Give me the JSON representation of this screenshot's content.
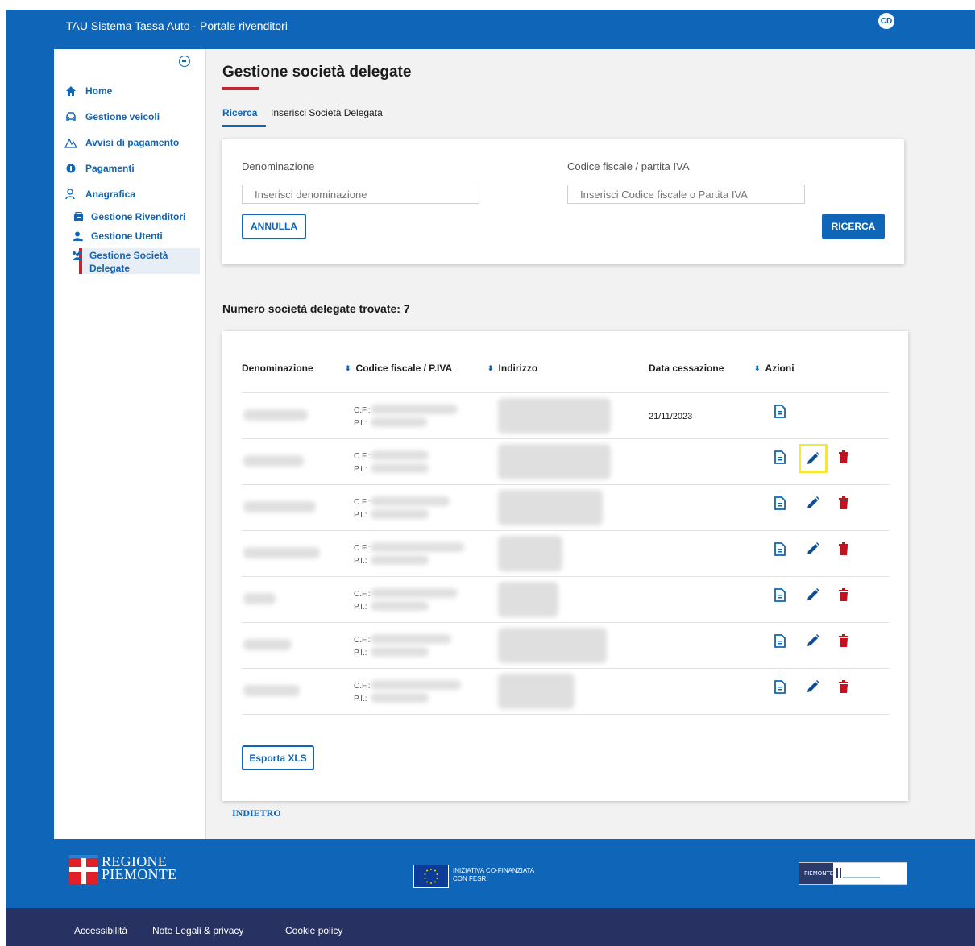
{
  "header": {
    "app_title": "TAU Sistema Tassa Auto - Portale rivenditori",
    "user_initials": "CD"
  },
  "sidebar": {
    "items": [
      {
        "label": "Home",
        "icon": "home-icon"
      },
      {
        "label": "Gestione veicoli",
        "icon": "car-icon"
      },
      {
        "label": "Avvisi di pagamento",
        "icon": "warning-triangle-icon"
      },
      {
        "label": "Pagamenti",
        "icon": "coin-icon"
      },
      {
        "label": "Anagrafica",
        "icon": "people-icon"
      }
    ],
    "subitems": [
      {
        "label": "Gestione Rivenditori",
        "icon": "store-icon"
      },
      {
        "label": "Gestione Utenti",
        "icon": "user-icon"
      },
      {
        "label": "Gestione Società Delegate",
        "icon": "group-icon",
        "active": true
      }
    ]
  },
  "page": {
    "title": "Gestione società delegate",
    "tabs": [
      "Ricerca",
      "Inserisci Società Delegata"
    ]
  },
  "search": {
    "denominazione_label": "Denominazione",
    "denominazione_placeholder": "Inserisci denominazione",
    "cf_label": "Codice fiscale / partita IVA",
    "cf_placeholder": "Inserisci Codice fiscale o Partita IVA",
    "cancel_label": "ANNULLA",
    "search_label": "RICERCA"
  },
  "results": {
    "count_text": "Numero società delegate trovate: 7",
    "columns": [
      "Denominazione",
      "Codice fiscale / P.IVA",
      "Indirizzo",
      "Data cessazione",
      "Azioni"
    ],
    "cf_prefix": "C.F.:",
    "pi_prefix": "P.I.:",
    "rows": [
      {
        "data_cessazione": "21/11/2023",
        "actions": [
          "view"
        ]
      },
      {
        "data_cessazione": "",
        "actions": [
          "view",
          "edit",
          "delete"
        ]
      },
      {
        "data_cessazione": "",
        "actions": [
          "view",
          "edit",
          "delete"
        ]
      },
      {
        "data_cessazione": "",
        "actions": [
          "view",
          "edit",
          "delete"
        ]
      },
      {
        "data_cessazione": "",
        "actions": [
          "view",
          "edit",
          "delete"
        ]
      },
      {
        "data_cessazione": "",
        "actions": [
          "view",
          "edit",
          "delete"
        ]
      },
      {
        "data_cessazione": "",
        "actions": [
          "view",
          "edit",
          "delete"
        ]
      }
    ],
    "export_label": "Esporta XLS"
  },
  "back_label": "INDIETRO",
  "footer": {
    "regione_line1": "REGIONE",
    "regione_line2": "PIEMONTE",
    "eu_line1": "INIZIATIVA CO-FINANZIATA",
    "eu_line2": "CON FESR",
    "partner_text": "PIEMONTE",
    "links": [
      "Accessibilità",
      "Note Legali & privacy",
      "Cookie policy"
    ]
  },
  "colors": {
    "brand_blue": "#0f66b8",
    "accent_red": "#c1272d",
    "footer_dark": "#273162",
    "highlight": "#f5e73b"
  }
}
